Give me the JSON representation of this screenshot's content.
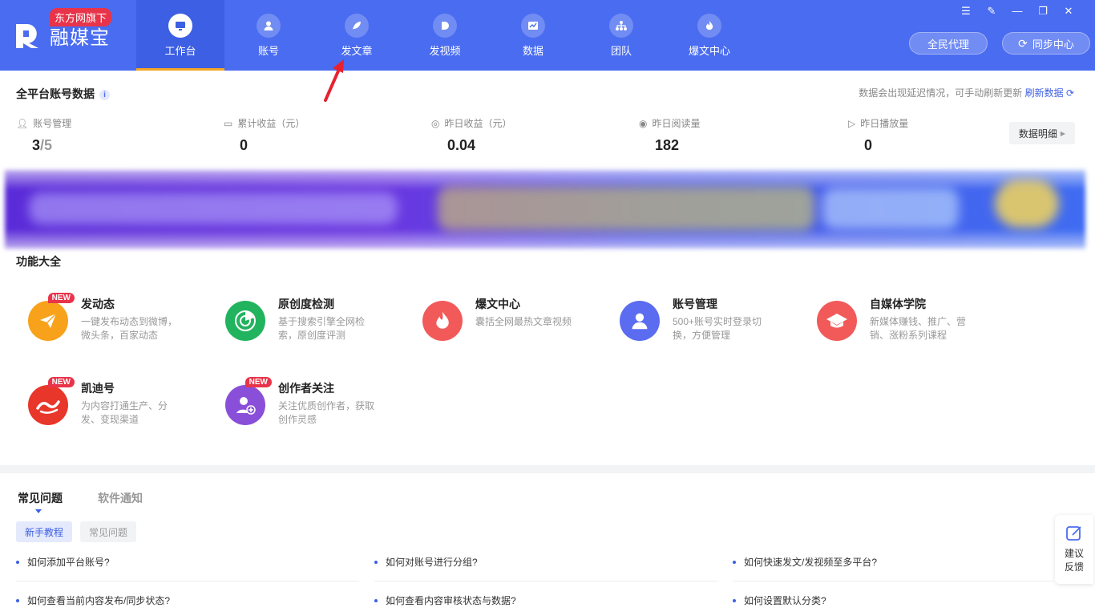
{
  "app": {
    "name": "融媒宝",
    "badge": "东方网旗下"
  },
  "nav": [
    {
      "label": "工作台",
      "active": true
    },
    {
      "label": "账号"
    },
    {
      "label": "发文章"
    },
    {
      "label": "发视频"
    },
    {
      "label": "数据"
    },
    {
      "label": "团队"
    },
    {
      "label": "爆文中心"
    }
  ],
  "window_controls": [
    "menu-icon",
    "edit-icon",
    "minimize-icon",
    "restore-icon",
    "close-icon"
  ],
  "top_buttons": {
    "agent": "全民代理",
    "sync": "同步中心"
  },
  "stats": {
    "title": "全平台账号数据",
    "note": "数据会出现延迟情况，可手动刷新更新",
    "refresh": "刷新数据",
    "items": [
      {
        "label": "账号管理",
        "value": "3",
        "value_den": "/5"
      },
      {
        "label": "累计收益（元）",
        "value": "0"
      },
      {
        "label": "昨日收益（元）",
        "value": "0.04"
      },
      {
        "label": "昨日阅读量",
        "value": "182"
      },
      {
        "label": "昨日播放量",
        "value": "0"
      }
    ],
    "detail_button": "数据明细"
  },
  "functions": {
    "title": "功能大全",
    "items": [
      {
        "name": "发动态",
        "desc": "一键发布动态到微博，微头条，百家动态",
        "new": "NEW"
      },
      {
        "name": "原创度检测",
        "desc": "基于搜索引擎全网检索，原创度评测"
      },
      {
        "name": "爆文中心",
        "desc": "囊括全网最热文章视频"
      },
      {
        "name": "账号管理",
        "desc": "500+账号实时登录切换，方便管理"
      },
      {
        "name": "自媒体学院",
        "desc": "新媒体赚钱、推广、营销、涨粉系列课程"
      },
      {
        "name": "凯迪号",
        "desc": "为内容打通生产、分发、变现渠道",
        "new": "NEW"
      },
      {
        "name": "创作者关注",
        "desc": "关注优质创作者，获取创作灵感",
        "new": "NEW"
      }
    ]
  },
  "faq": {
    "tabs": [
      "常见问题",
      "软件通知"
    ],
    "chips": [
      "新手教程",
      "常见问题"
    ],
    "questions": [
      "如何添加平台账号?",
      "如何对账号进行分组?",
      "如何快速发文/发视频至多平台?",
      "如何查看当前内容发布/同步状态?",
      "如何查看内容审核状态与数据?",
      "如何设置默认分类?"
    ]
  },
  "feedback": {
    "line1": "建议",
    "line2": "反馈"
  },
  "colors": {
    "brand": "#4a6cf0",
    "accent": "#f5a623",
    "badge": "#e8344a"
  }
}
